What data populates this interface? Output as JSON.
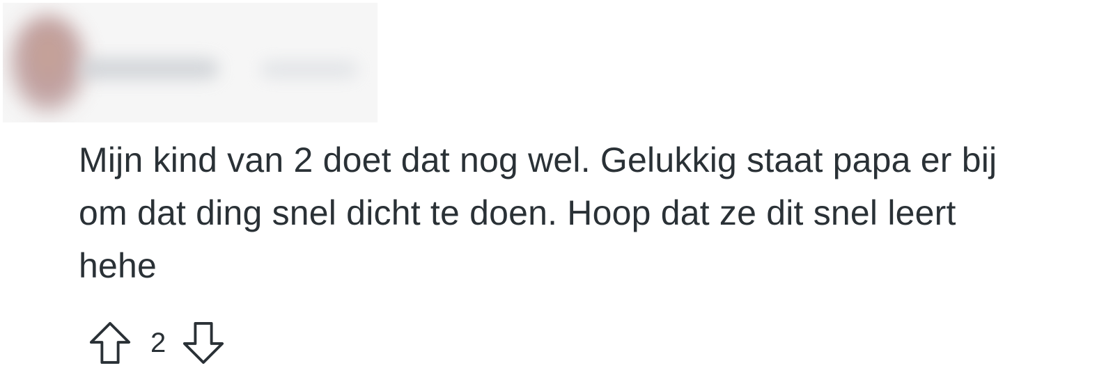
{
  "comment": {
    "author": {
      "avatar_icon": "user-avatar-redacted",
      "redacted": true
    },
    "body_lines": [
      "Mijn kind van 2 doet dat nog wel. Gelukkig staat papa er bij",
      "om dat ding snel dicht te doen. Hoop dat ze dit snel leert",
      "hehe"
    ],
    "votes": {
      "upvote_icon": "arrow-up-outline-icon",
      "score": "2",
      "downvote_icon": "arrow-down-outline-icon"
    }
  },
  "colors": {
    "text": "#2a3136",
    "background": "#ffffff",
    "icon_stroke": "#2a3136"
  }
}
